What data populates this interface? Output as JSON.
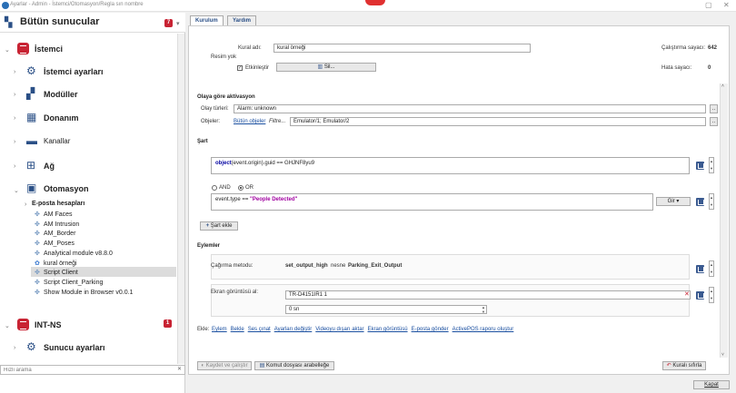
{
  "window": {
    "title": "Ayarlar - Admin - İstemci/Otomasyon/Regla sın nombre"
  },
  "servers": {
    "label": "Bütün sunucular",
    "badge": "7"
  },
  "tree": {
    "client": "İstemci",
    "client_settings": "İstemci ayarları",
    "modules": "Modüller",
    "hardware": "Donanım",
    "channels": "Kanallar",
    "network": "Ağ",
    "automation": "Otomasyon",
    "email_accounts": "E-posta hesapları",
    "rules": [
      "AM Faces",
      "AM Intrusion",
      "AM_Border",
      "AM_Poses",
      "Analytical module v8.8.0",
      "kural örneği",
      "Script Client",
      "Script Client_Parking",
      "Show Module in Browser v0.0.1"
    ],
    "server2": "INT-NS",
    "server2_badge": "1",
    "server_settings": "Sunucu ayarları"
  },
  "search": {
    "placeholder": "Hızlı arama"
  },
  "tabs": {
    "setup": "Kurulum",
    "help": "Yardım"
  },
  "rule": {
    "name_label": "Kural adı:",
    "name_value": "kural örneği",
    "no_image": "Resim yok",
    "enable_label": "Etkinleştir",
    "delete_label": "Sil...",
    "run_counter_label": "Çalıştırma sayacı:",
    "run_counter_value": "642",
    "error_counter_label": "Hata sayacı:",
    "error_counter_value": "0"
  },
  "event": {
    "section": "Olaya göre aktivasyon",
    "types_label": "Olay türleri:",
    "types_value": "Alarm: unknown",
    "objects_label": "Objeler:",
    "all_objects": "Bütün objeler",
    "filter": "Filtre...",
    "objects_value": "Emulator/1; Emulator/2",
    "dots": ".."
  },
  "condition": {
    "section": "Şart",
    "expr1_kw": "object",
    "expr1_rest": "(event.origin).guid == GHJNF8yu9",
    "and": "AND",
    "or": "OR",
    "expr2_prefix": "event.type == ",
    "expr2_str": "\"People Detected\"",
    "enter": "Gir",
    "add": "Şart ekle"
  },
  "actions": {
    "section": "Eylemler",
    "method_label": "Çağırma metodu:",
    "method": "set_output_high",
    "object_word": "nesne",
    "object": "Parking_Exit_Output",
    "screenshot_label": "Ekran görüntüsü al:",
    "screenshot_value": "TR-D4151IR1 1",
    "seconds": "0 sn",
    "add_label": "Ekle:",
    "add_links": [
      "Eylem",
      "Bekle",
      "Ses çınat",
      "Ayarları değiştir",
      "Videoyu dışarı aktar",
      "Ekran görüntüsü",
      "E-posta gönder",
      "ActivePOS raporu oluştur"
    ]
  },
  "footer": {
    "save_run": "Kaydet ve çalıştır",
    "copy_script": "Komut dosyası arabelleğe",
    "reset": "Kuralı sıfırla",
    "close": "Kapat"
  }
}
